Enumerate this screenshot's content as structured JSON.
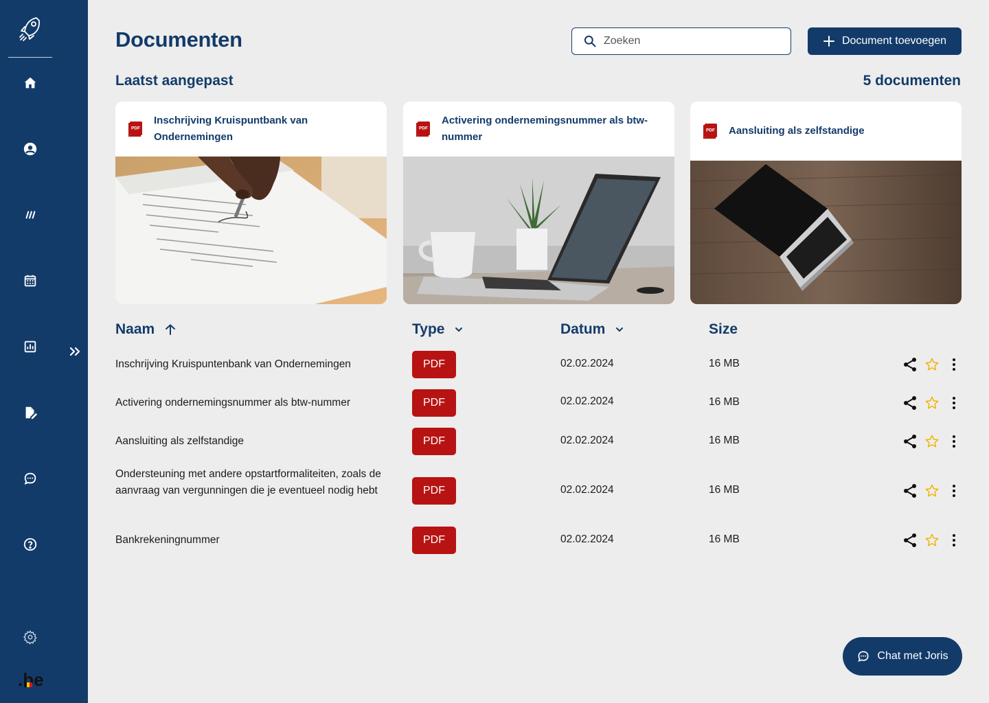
{
  "sidebar": {
    "items": [
      {
        "icon": "home-icon"
      },
      {
        "icon": "user-circle-icon"
      },
      {
        "icon": "slashes-icon"
      },
      {
        "icon": "calendar-icon"
      },
      {
        "icon": "chart-icon"
      },
      {
        "icon": "document-edit-icon"
      },
      {
        "icon": "chat-icon"
      },
      {
        "icon": "help-icon"
      }
    ],
    "expand_icon": "double-chevron-right-icon",
    "settings_icon": "gear-icon",
    "brand_logo": ".be"
  },
  "header": {
    "title": "Documenten",
    "search_placeholder": "Zoeken",
    "add_button": "Document toevoegen"
  },
  "recent": {
    "title": "Laatst aangepast",
    "count": "5 documenten",
    "cards": [
      {
        "title": "Inschrijving Kruispuntbank van Ondernemingen",
        "image": "hand signing paper document"
      },
      {
        "title": "Activering ondernemingsnummer als btw-nummer",
        "image": "laptop with coffee cup and plant"
      },
      {
        "title": "Aansluiting als zelfstandige",
        "image": "laptop on wooden table"
      }
    ]
  },
  "table": {
    "columns": {
      "name": "Naam",
      "type": "Type",
      "date": "Datum",
      "size": "Size"
    },
    "rows": [
      {
        "name": "Inschrijving Kruispuntenbank van Ondernemingen",
        "type": "PDF",
        "date": "02.02.2024",
        "size": "16 MB"
      },
      {
        "name": "Activering ondernemingsnummer als btw-nummer",
        "type": "PDF",
        "date": "02.02.2024",
        "size": "16 MB"
      },
      {
        "name": "Aansluiting als zelfstandige",
        "type": "PDF",
        "date": "02.02.2024",
        "size": "16 MB"
      },
      {
        "name": "Ondersteuning met andere opstartformaliteiten, zoals de aanvraag van vergunningen die je eventueel nodig hebt",
        "type": "PDF",
        "date": "02.02.2024",
        "size": "16 MB"
      },
      {
        "name": "Bankrekeningnummer",
        "type": "PDF",
        "date": "02.02.2024",
        "size": "16 MB"
      }
    ]
  },
  "chat": {
    "label": "Chat met Joris"
  },
  "colors": {
    "primary": "#133b6a",
    "pdf": "#b81313",
    "star": "#f2b400",
    "background": "#ededed"
  }
}
